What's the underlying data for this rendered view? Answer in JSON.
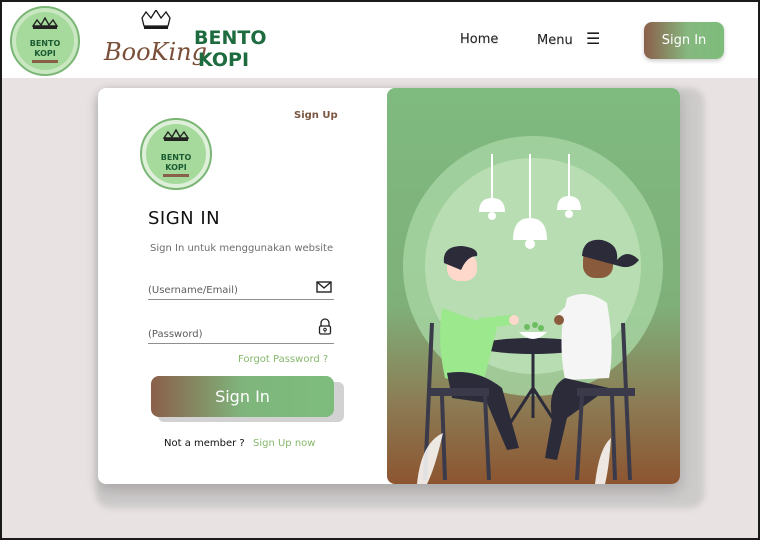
{
  "header": {
    "nav_home": "Home",
    "nav_menu": "Menu",
    "menu_icon": "☰",
    "signin_label": "Sign In"
  },
  "brand": {
    "word1": "BooKing",
    "word2_top": "BENTO",
    "word2_bottom": "KOPI",
    "badge_top": "BENTO",
    "badge_bottom": "KOPI"
  },
  "card": {
    "signup_top": "Sign Up",
    "title": "SIGN IN",
    "subtitle": "Sign In untuk menggunakan website",
    "username_placeholder": "(Username/Email)",
    "password_placeholder": "(Password)",
    "forgot": "Forgot Password ?",
    "signin_button": "Sign In",
    "member_text": "Not a member ?",
    "signup_now": "Sign Up now"
  },
  "icons": {
    "menu": "hamburger-icon",
    "email": "mail-icon",
    "password": "lock-icon",
    "logo": "crown-icon"
  },
  "colors": {
    "accent_green": "#7dbd7c",
    "accent_brown": "#8a5f4a",
    "link_green": "#86b86c",
    "background": "#e8e2e2"
  }
}
